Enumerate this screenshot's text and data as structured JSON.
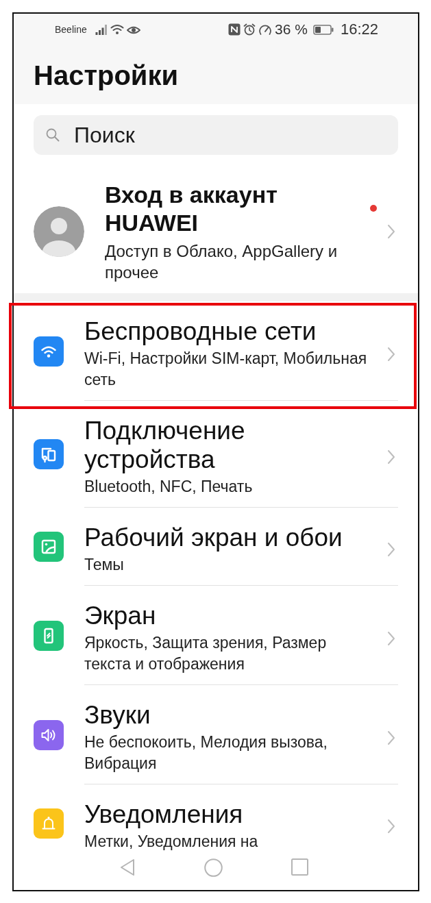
{
  "status_bar": {
    "carrier": "Beeline",
    "battery": "36 %",
    "time": "16:22"
  },
  "header": {
    "title": "Настройки"
  },
  "search": {
    "placeholder": "Поиск"
  },
  "account": {
    "title": "Вход в аккаунт HUAWEI",
    "subtitle": "Доступ в Облако, AppGallery и прочее",
    "notification_dot": true
  },
  "items": [
    {
      "title": "Беспроводные сети",
      "subtitle": "Wi-Fi, Настройки SIM-карт, Мобильная сеть",
      "color": "#2287f3",
      "highlighted": true
    },
    {
      "title": "Подключение устройства",
      "subtitle": "Bluetooth, NFC, Печать",
      "color": "#2287f3",
      "highlighted": false
    },
    {
      "title": "Рабочий экран и обои",
      "subtitle": "Темы",
      "color": "#22c47a",
      "highlighted": false
    },
    {
      "title": "Экран",
      "subtitle": "Яркость, Защита зрения, Размер текста и отображения",
      "color": "#22c47a",
      "highlighted": false
    },
    {
      "title": "Звуки",
      "subtitle": "Не беспокоить, Мелодия вызова, Вибрация",
      "color": "#8b66ee",
      "highlighted": false
    },
    {
      "title": "Уведомления",
      "subtitle": "Метки, Уведомления на",
      "color": "#fbc41a",
      "highlighted": false
    }
  ]
}
